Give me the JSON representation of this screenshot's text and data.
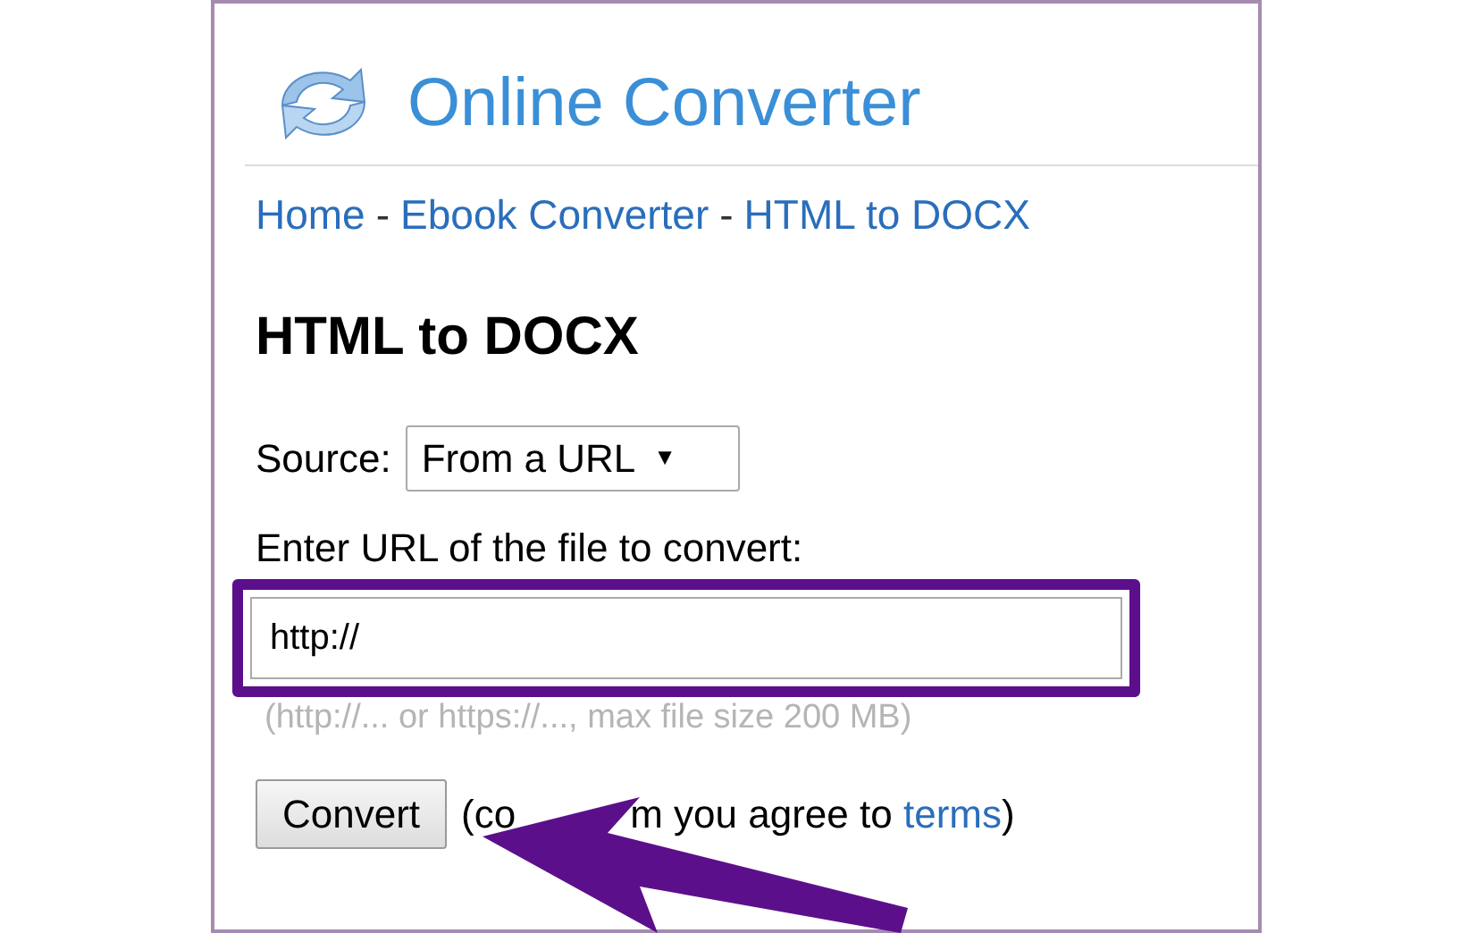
{
  "site": {
    "title": "Online Converter"
  },
  "breadcrumb": [
    {
      "label": "Home"
    },
    {
      "label": "Ebook Converter"
    },
    {
      "label": "HTML to DOCX"
    }
  ],
  "breadcrumb_separator": "-",
  "heading": "HTML to DOCX",
  "source": {
    "label": "Source:",
    "value": "From a URL",
    "caret": "▼"
  },
  "url_field": {
    "label": "Enter URL of the file to convert:",
    "value": "http://",
    "highlighted": true,
    "hint": "(http://... or https://..., max file size 200 MB)"
  },
  "convert": {
    "button": "Convert",
    "note_before": "(co",
    "note_after": "m you agree to ",
    "link": "terms",
    "note_end": ")"
  }
}
